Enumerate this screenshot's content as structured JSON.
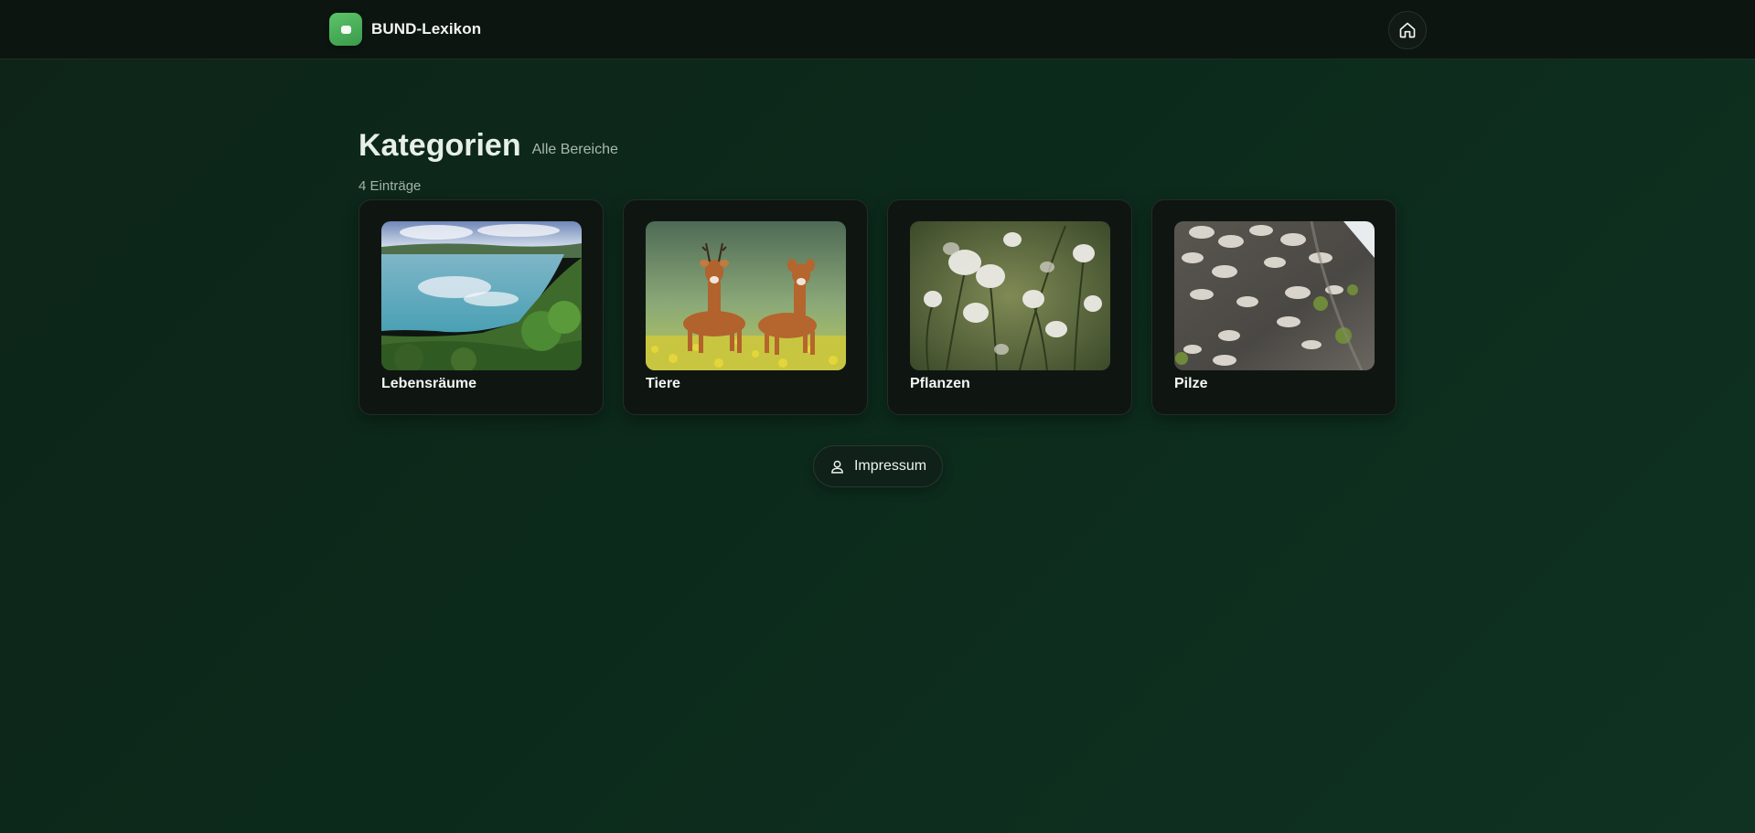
{
  "header": {
    "brand_name": "BUND-Lexikon",
    "home_icon": "home-icon"
  },
  "main": {
    "title": "Kategorien",
    "subtitle": "Alle Bereiche",
    "count_label": "4 Einträge",
    "categories": [
      {
        "label": "Lebensräume",
        "image": "lake-landscape-image"
      },
      {
        "label": "Tiere",
        "image": "deer-in-field-image"
      },
      {
        "label": "Pflanzen",
        "image": "cotton-grass-image"
      },
      {
        "label": "Pilze",
        "image": "bracket-fungi-image"
      }
    ]
  },
  "footer": {
    "impressum_label": "Impressum",
    "impressum_icon": "user-icon"
  },
  "colors": {
    "background": "#0c2a1b",
    "topbar": "#0d1511",
    "card": "#0f1612",
    "brand_accent": "#4caf5a"
  }
}
